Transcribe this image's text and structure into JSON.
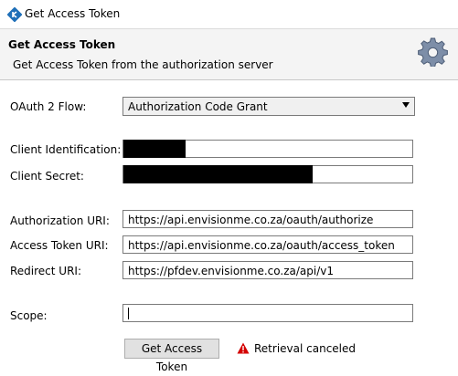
{
  "window": {
    "title": "Get Access Token"
  },
  "header": {
    "title": "Get Access Token",
    "subtitle": "Get Access Token from the authorization server",
    "icon": "gear-icon"
  },
  "form": {
    "flow_label": "OAuth 2 Flow:",
    "flow_value": "Authorization Code Grant",
    "client_id_label": "Client Identification:",
    "client_secret_label": "Client Secret:",
    "auth_uri_label": "Authorization URI:",
    "auth_uri_value": "https://api.envisionme.co.za/oauth/authorize",
    "token_uri_label": "Access Token URI:",
    "token_uri_value": "https://api.envisionme.co.za/oauth/access_token",
    "redirect_uri_label": "Redirect URI:",
    "redirect_uri_value": "https://pfdev.envisionme.co.za/api/v1",
    "scope_label": "Scope:",
    "scope_value": ""
  },
  "actions": {
    "get_token_label": "Get Access Token"
  },
  "status": {
    "icon": "warning-icon",
    "text": "Retrieval canceled",
    "color": "#d40000"
  }
}
